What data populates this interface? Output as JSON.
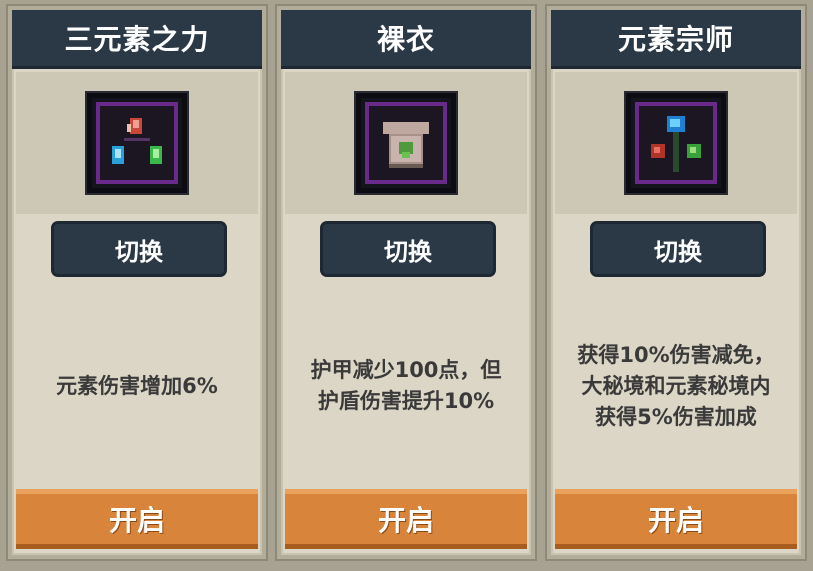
{
  "cards": [
    {
      "title": "三元素之力",
      "icon": "three-elements-icon",
      "switch_label": "切换",
      "description_lines": [
        "元素伤害增加6%"
      ],
      "open_label": "开启"
    },
    {
      "title": "裸衣",
      "icon": "bare-shirt-icon",
      "switch_label": "切换",
      "description_lines": [
        "护甲减少100点，但",
        "护盾伤害提升10%"
      ],
      "open_label": "开启"
    },
    {
      "title": "元素宗师",
      "icon": "element-master-icon",
      "switch_label": "切换",
      "description_lines": [
        "获得10%伤害减免，",
        "大秘境和元素秘境内",
        "获得5%伤害加成"
      ],
      "open_label": "开启"
    }
  ],
  "colors": {
    "title_bg": "#2b3947",
    "card_bg": "#dcd6c6",
    "open_button": "#d8843a",
    "icon_border": "#6a2a8c"
  }
}
